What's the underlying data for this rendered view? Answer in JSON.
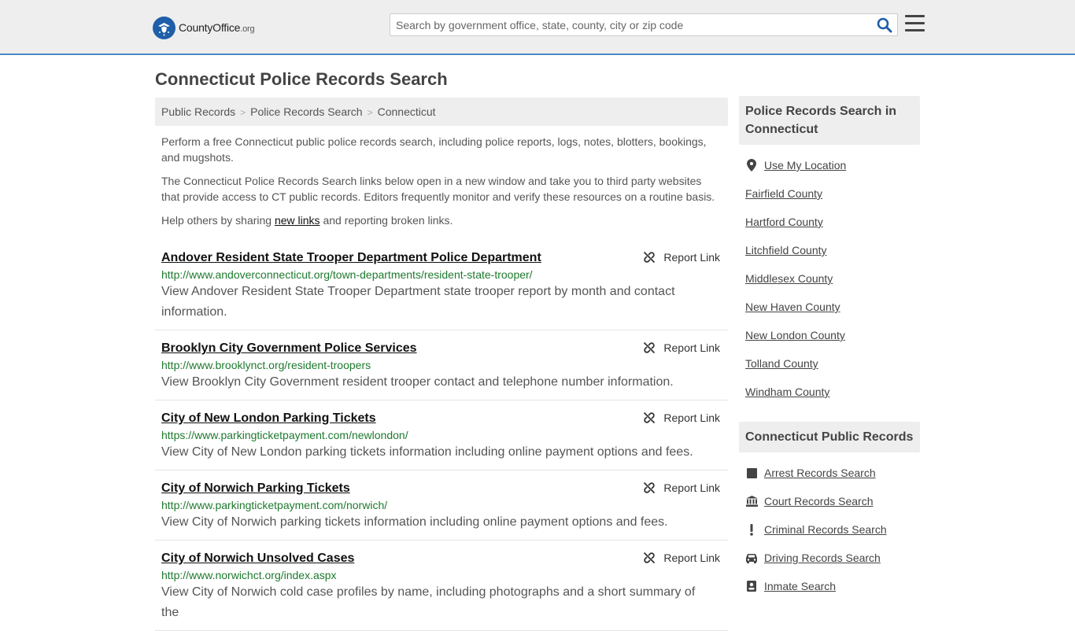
{
  "header": {
    "logo_text_main": "CountyOffice",
    "logo_text_org": ".org",
    "search_placeholder": "Search by government office, state, county, city or zip code",
    "search_value": ""
  },
  "page": {
    "title": "Connecticut Police Records Search"
  },
  "breadcrumb": [
    "Public Records",
    "Police Records Search",
    "Connecticut"
  ],
  "intro": {
    "p1": "Perform a free Connecticut public police records search, including police reports, logs, notes, blotters, bookings, and mugshots.",
    "p2": "The Connecticut Police Records Search links below open in a new window and take you to third party websites that provide access to CT public records. Editors frequently monitor and verify these resources on a routine basis.",
    "p3_before": "Help others by sharing ",
    "p3_link": "new links",
    "p3_after": " and reporting broken links."
  },
  "report_label": "Report Link",
  "results": [
    {
      "title": "Andover Resident State Trooper Department Police Department",
      "url": "http://www.andoverconnecticut.org/town-departments/resident-state-trooper/",
      "desc": "View Andover Resident State Trooper Department state trooper report by month and contact information."
    },
    {
      "title": "Brooklyn City Government Police Services",
      "url": "http://www.brooklynct.org/resident-troopers",
      "desc": "View Brooklyn City Government resident trooper contact and telephone number information."
    },
    {
      "title": "City of New London Parking Tickets",
      "url": "https://www.parkingticketpayment.com/newlondon/",
      "desc": "View City of New London parking tickets information including online payment options and fees."
    },
    {
      "title": "City of Norwich Parking Tickets",
      "url": "http://www.parkingticketpayment.com/norwich/",
      "desc": "View City of Norwich parking tickets information including online payment options and fees."
    },
    {
      "title": "City of Norwich Unsolved Cases",
      "url": "http://www.norwichct.org/index.aspx",
      "desc": "View City of Norwich cold case profiles by name, including photographs and a short summary of the"
    }
  ],
  "sidebar": {
    "section1_title": "Police Records Search in Connecticut",
    "use_location": "Use My Location",
    "counties": [
      "Fairfield County",
      "Hartford County",
      "Litchfield County",
      "Middlesex County",
      "New Haven County",
      "New London County",
      "Tolland County",
      "Windham County"
    ],
    "section2_title": "Connecticut Public Records",
    "public_records": [
      {
        "label": "Arrest Records Search",
        "icon": "square-icon"
      },
      {
        "label": "Court Records Search",
        "icon": "courthouse-icon"
      },
      {
        "label": "Criminal Records Search",
        "icon": "exclamation-icon"
      },
      {
        "label": "Driving Records Search",
        "icon": "car-icon"
      },
      {
        "label": "Inmate Search",
        "icon": "id-badge-icon"
      }
    ]
  },
  "colors": {
    "accent": "#4a89c8",
    "url_green": "#1e7a2e",
    "logo_blue": "#1f5ea8"
  }
}
